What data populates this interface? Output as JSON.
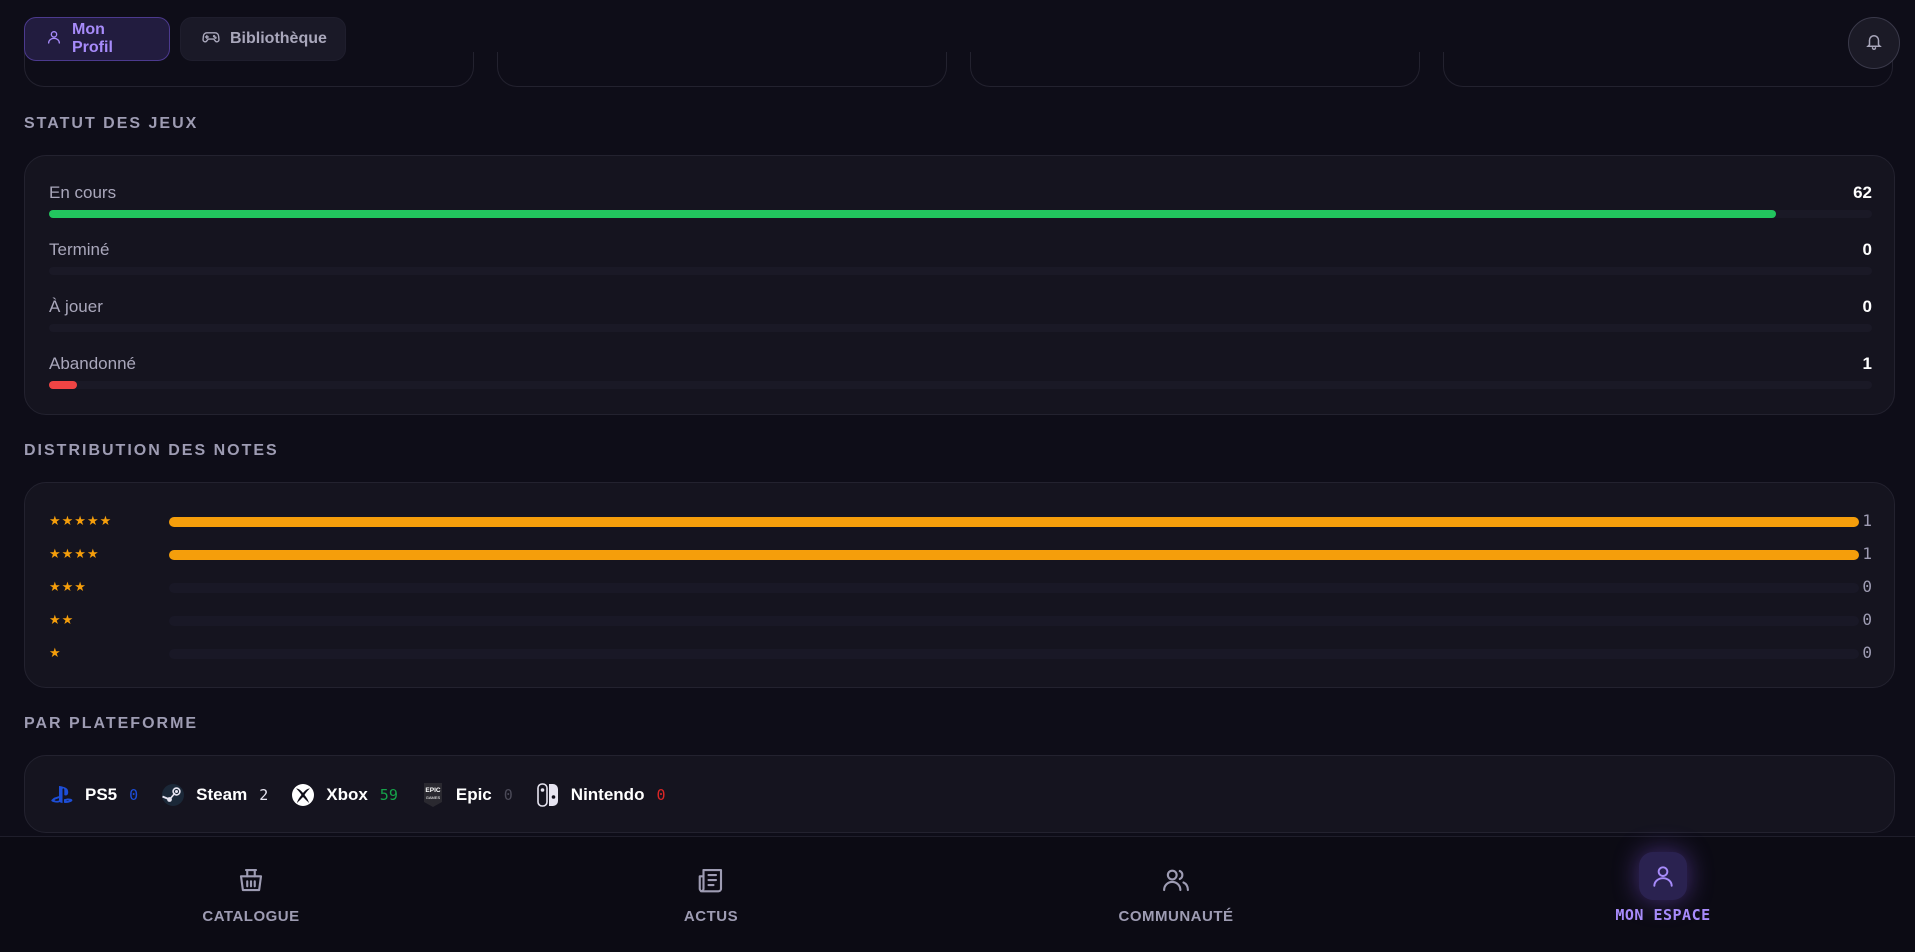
{
  "header": {
    "tabs": [
      {
        "label": "Mon Profil",
        "icon": "user-icon",
        "active": true
      },
      {
        "label": "Bibliothèque",
        "icon": "gamepad-icon",
        "active": false
      }
    ],
    "notification_icon": "bell-icon"
  },
  "status": {
    "title": "STATUT DES JEUX",
    "max": 62,
    "items": [
      {
        "label": "En cours",
        "value": "62",
        "count": 62,
        "color": "#22c55e"
      },
      {
        "label": "Terminé",
        "value": "0",
        "count": 0,
        "color": "#3b82f6"
      },
      {
        "label": "À jouer",
        "value": "0",
        "count": 0,
        "color": "#a78bfa"
      },
      {
        "label": "Abandonné",
        "value": "1",
        "count": 1,
        "color": "#ef4444"
      }
    ]
  },
  "ratings": {
    "title": "DISTRIBUTION DES NOTES",
    "max": 1,
    "items": [
      {
        "stars": "★★★★★",
        "value": "1",
        "count": 1
      },
      {
        "stars": "★★★★",
        "value": "1",
        "count": 1
      },
      {
        "stars": "★★★",
        "value": "0",
        "count": 0
      },
      {
        "stars": "★★",
        "value": "0",
        "count": 0
      },
      {
        "stars": "★",
        "value": "0",
        "count": 0
      }
    ],
    "color": "#f59e0b"
  },
  "platforms": {
    "title": "PAR PLATEFORME",
    "items": [
      {
        "name": "PS5",
        "count": "0",
        "icon": "playstation-icon",
        "color": "#1d4ed8"
      },
      {
        "name": "Steam",
        "count": "2",
        "icon": "steam-icon",
        "color": "#e6e4f0"
      },
      {
        "name": "Xbox",
        "count": "59",
        "icon": "xbox-icon",
        "color": "#16a34a"
      },
      {
        "name": "Epic",
        "count": "0",
        "icon": "epic-games-icon",
        "color": "#4b4a58"
      },
      {
        "name": "Nintendo",
        "count": "0",
        "icon": "nintendo-switch-icon",
        "color": "#dc2626"
      }
    ]
  },
  "nav": {
    "items": [
      {
        "label": "CATALOGUE",
        "icon": "shopping-basket-icon",
        "active": false
      },
      {
        "label": "ACTUS",
        "icon": "newspaper-icon",
        "active": false
      },
      {
        "label": "COMMUNAUTÉ",
        "icon": "users-icon",
        "active": false
      },
      {
        "label": "MON ESPACE",
        "icon": "user-icon",
        "active": true
      }
    ]
  }
}
